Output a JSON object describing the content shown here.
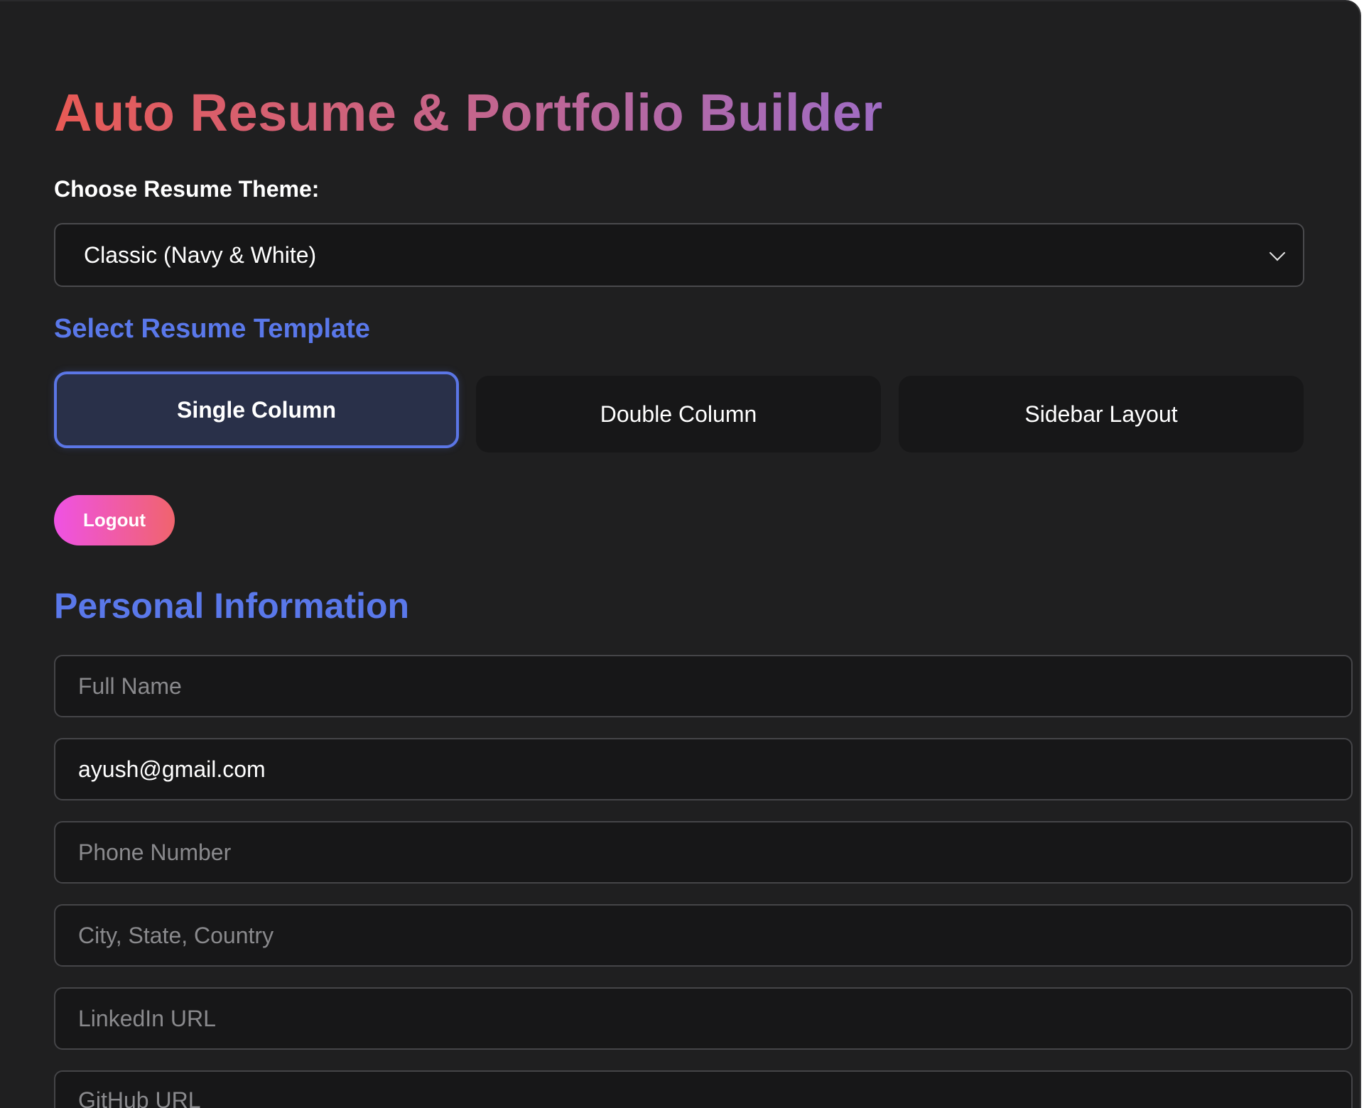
{
  "app": {
    "title": "Auto Resume & Portfolio Builder"
  },
  "theme": {
    "label": "Choose Resume Theme:",
    "selected": "Classic (Navy & White)",
    "icon": "chevron-down-icon"
  },
  "templates": {
    "heading": "Select Resume Template",
    "options": [
      {
        "label": "Single Column",
        "selected": true
      },
      {
        "label": "Double Column",
        "selected": false
      },
      {
        "label": "Sidebar Layout",
        "selected": false
      }
    ]
  },
  "logout": {
    "label": "Logout"
  },
  "personal": {
    "heading": "Personal Information",
    "fields": [
      {
        "placeholder": "Full Name",
        "value": ""
      },
      {
        "placeholder": "",
        "value": "ayush@gmail.com"
      },
      {
        "placeholder": "Phone Number",
        "value": ""
      },
      {
        "placeholder": "City, State, Country",
        "value": ""
      },
      {
        "placeholder": "LinkedIn URL",
        "value": ""
      },
      {
        "placeholder": "GitHub URL",
        "value": ""
      }
    ]
  },
  "colors": {
    "background": "#1f1f20",
    "accent_blue": "#5a78ea",
    "title_gradient_start": "#e85a55",
    "title_gradient_end": "#9f6cc4",
    "logout_gradient_start": "#ef52e4",
    "logout_gradient_end": "#f0646d"
  }
}
